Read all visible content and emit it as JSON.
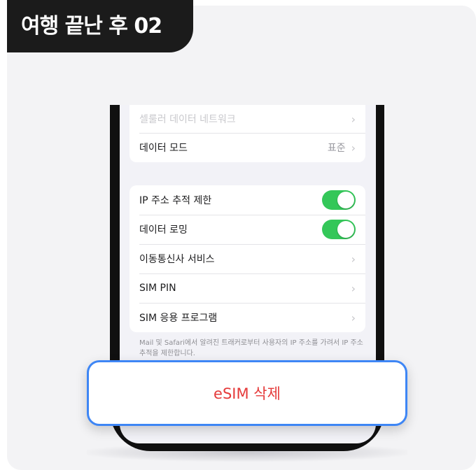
{
  "badge": {
    "title": "여행 끝난 후 02"
  },
  "settings": {
    "top_group": [
      {
        "label": "셀룰러 데이터 네트워크",
        "faded": true
      },
      {
        "label": "데이터 모드",
        "value": "표준"
      }
    ],
    "main_group": [
      {
        "label": "IP 주소 추적 제한",
        "control": "toggle",
        "on": true
      },
      {
        "label": "데이터 로밍",
        "control": "toggle",
        "on": true
      },
      {
        "label": "이동통신사 서비스",
        "control": "chevron"
      },
      {
        "label": "SIM PIN",
        "control": "chevron"
      },
      {
        "label": "SIM 응용 프로그램",
        "control": "chevron"
      }
    ],
    "footnote": "Mail 및 Safari에서 알려진 트래커로부터 사용자의 IP 주소를 가려서 IP 주소 추적을 제한합니다."
  },
  "esim_button": {
    "label": "eSIM 삭제"
  },
  "icons": {
    "chevron": "chevron-right-icon",
    "toggle": "toggle-switch"
  },
  "colors": {
    "toggle_on": "#34c759",
    "button_border": "#3e86f5",
    "destructive": "#e53a3a",
    "badge_bg": "#1b1b1b"
  }
}
